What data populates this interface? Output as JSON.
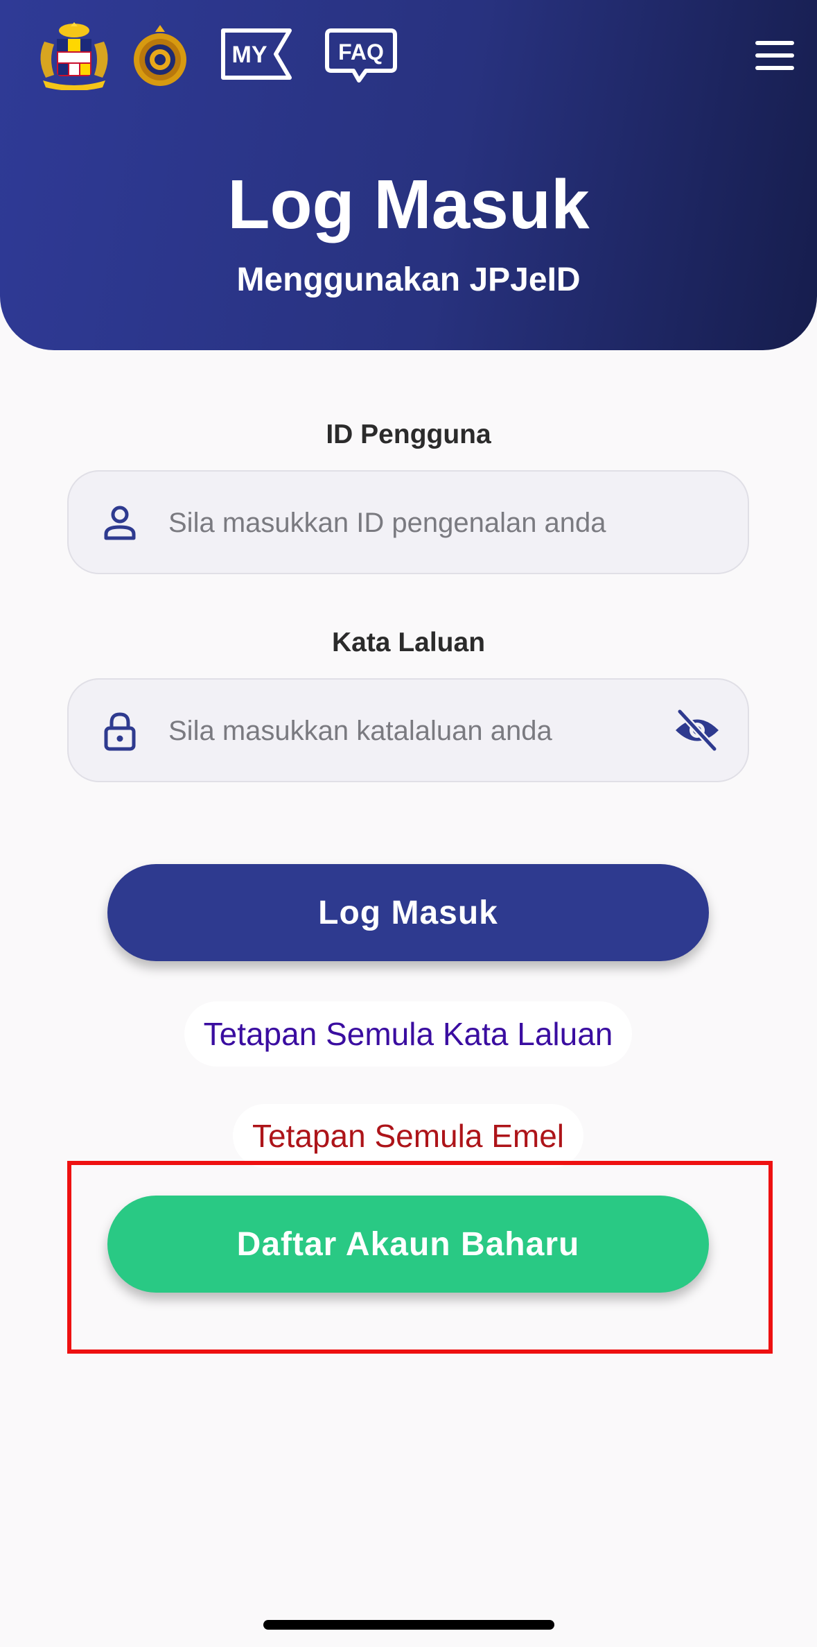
{
  "header": {
    "title": "Log Masuk",
    "subtitle": "Menggunakan JPJeID",
    "background_colors": [
      "#2f3a96",
      "#161d4d"
    ],
    "logos": [
      {
        "name": "malaysia-coat-of-arms",
        "icon": "crest-logo"
      },
      {
        "name": "jpj-logo",
        "icon": "jpj-emblem"
      }
    ],
    "my_badge_label": "MY",
    "faq_badge_label": "FAQ",
    "menu_icon": "hamburger-menu-icon"
  },
  "form": {
    "user_id": {
      "label": "ID Pengguna",
      "placeholder": "Sila masukkan ID pengenalan anda",
      "value": "",
      "icon": "user-icon"
    },
    "password": {
      "label": "Kata Laluan",
      "placeholder": "Sila masukkan katalaluan anda",
      "value": "",
      "icon": "lock-icon",
      "toggle_icon": "eye-slash-icon"
    }
  },
  "actions": {
    "login_label": "Log Masuk",
    "reset_password_label": "Tetapan Semula Kata Laluan",
    "reset_email_label": "Tetapan Semula Emel",
    "register_label": "Daftar Akaun Baharu"
  },
  "colors": {
    "primary": "#2e3a8f",
    "success": "#29c984",
    "link_purple": "#3a0da0",
    "link_red": "#ad1419",
    "highlight": "#ee1111"
  }
}
